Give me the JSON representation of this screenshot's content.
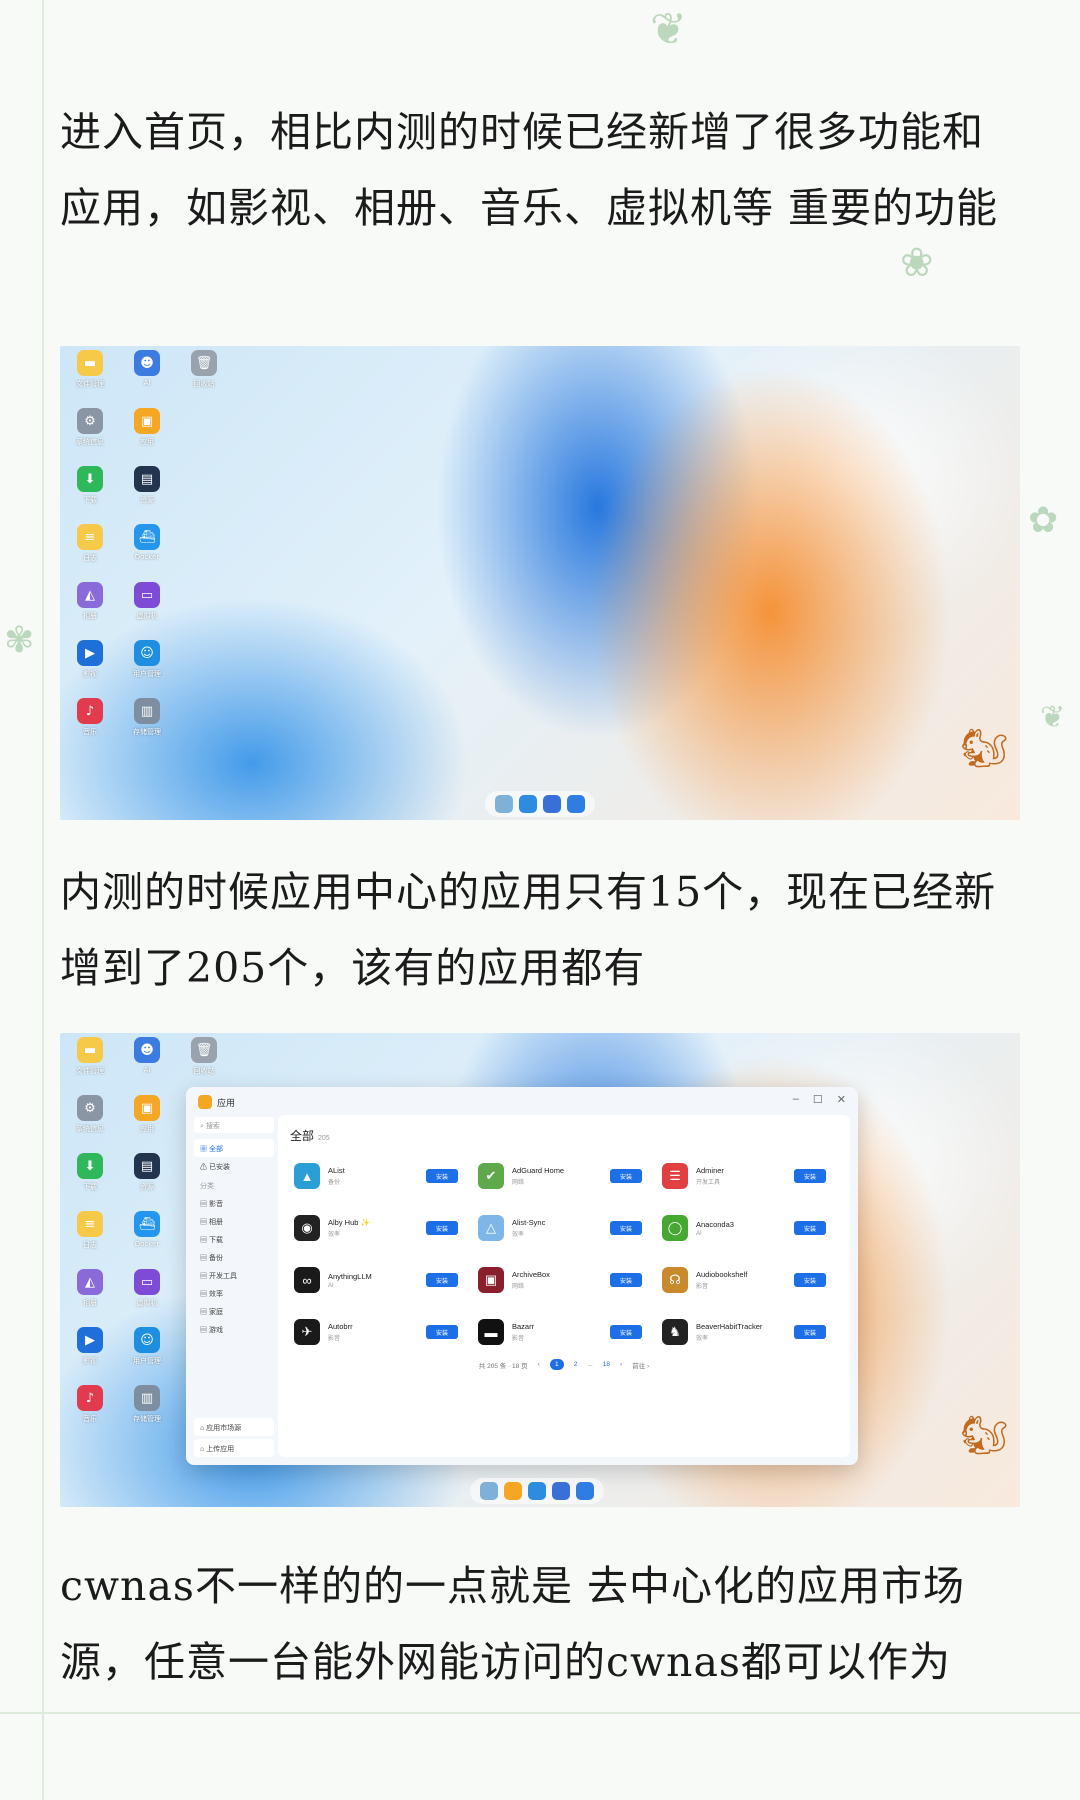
{
  "paragraphs": {
    "p1": "进入首页，相比内测的时候已经新增了很多功能和应用，如影视、相册、音乐、虚拟机等 重要的功能",
    "p2": "内测的时候应用中心的应用只有15个，现在已经新增到了205个，该有的应用都有",
    "p3": "cwnas不一样的的一点就是 去中心化的应用市场源，任意一台能外网能访问的cwnas都可以作为"
  },
  "desktop": {
    "icons": [
      {
        "label": "文件管理",
        "icon": "folder-icon",
        "color": "#f7c948"
      },
      {
        "label": "AI",
        "icon": "robot-icon",
        "color": "#3c7be0"
      },
      {
        "label": "回收站",
        "icon": "trash-icon",
        "color": "#9aa3ad"
      },
      {
        "label": "系统信息",
        "icon": "gear-icon",
        "color": "#8a96a3"
      },
      {
        "label": "应用",
        "icon": "app-store-icon",
        "color": "#f5a623"
      },
      {
        "label": "下载",
        "icon": "download-icon",
        "color": "#2fb85a"
      },
      {
        "label": "资源",
        "icon": "monitor-icon",
        "color": "#23344f"
      },
      {
        "label": "日志",
        "icon": "notes-icon",
        "color": "#f7c948"
      },
      {
        "label": "Docker",
        "icon": "docker-icon",
        "color": "#2496ed"
      },
      {
        "label": "相册",
        "icon": "photos-icon",
        "color": "#8a6ad8"
      },
      {
        "label": "虚拟机",
        "icon": "vm-icon",
        "color": "#7d4bd6"
      },
      {
        "label": "影视",
        "icon": "clapperboard-icon",
        "color": "#1e6fd9"
      },
      {
        "label": "用户管理",
        "icon": "users-icon",
        "color": "#1e8fe0"
      },
      {
        "label": "音乐",
        "icon": "music-icon",
        "color": "#e23b4e"
      },
      {
        "label": "存储管理",
        "icon": "storage-icon",
        "color": "#7d8ea0"
      }
    ],
    "dock1": [
      "#7fb0d8",
      "#2d8be0",
      "#3b6fd8",
      "#2f7de3"
    ],
    "dock2": [
      "#7fb0d8",
      "#f5a623",
      "#2d8be0",
      "#3b6fd8",
      "#2f7de3"
    ]
  },
  "appwin": {
    "title": "应用",
    "search_placeholder": "搜索",
    "nav": [
      {
        "label": "全部",
        "active": true
      },
      {
        "label": "已安装",
        "active": false
      }
    ],
    "group_label": "分类",
    "categories": [
      "影音",
      "相册",
      "下载",
      "备份",
      "开发工具",
      "效率",
      "家庭",
      "游戏"
    ],
    "bottom": [
      "应用市场源",
      "上传应用"
    ],
    "header": "全部",
    "header_count": "205",
    "install_label": "安装",
    "apps": [
      {
        "name": "AList",
        "cat": "备份",
        "icon": "alist-icon",
        "color": "#2a9fd6"
      },
      {
        "name": "AdGuard Home",
        "cat": "网络",
        "icon": "shield-check-icon",
        "color": "#5fa84c"
      },
      {
        "name": "Adminer",
        "cat": "开发工具",
        "icon": "database-icon",
        "color": "#e04040"
      },
      {
        "name": "Alby Hub ✨",
        "cat": "效率",
        "icon": "alby-icon",
        "color": "#222222"
      },
      {
        "name": "Alist-Sync",
        "cat": "效率",
        "icon": "alist-sync-icon",
        "color": "#7fb6e8"
      },
      {
        "name": "Anaconda3",
        "cat": "AI",
        "icon": "ring-icon",
        "color": "#44a833"
      },
      {
        "name": "AnythingLLM",
        "cat": "AI",
        "icon": "infinity-icon",
        "color": "#1a1a1a"
      },
      {
        "name": "ArchiveBox",
        "cat": "网络",
        "icon": "archive-icon",
        "color": "#8a1e2a"
      },
      {
        "name": "Audiobookshelf",
        "cat": "影音",
        "icon": "headphones-icon",
        "color": "#c88a2a"
      },
      {
        "name": "Autobrr",
        "cat": "影音",
        "icon": "bird-icon",
        "color": "#1a1a1a"
      },
      {
        "name": "Bazarr",
        "cat": "影音",
        "icon": "subtitle-icon",
        "color": "#111111"
      },
      {
        "name": "BeaverHabitTracker",
        "cat": "效率",
        "icon": "beaver-icon",
        "color": "#222222"
      }
    ],
    "pager": {
      "summary": "共 205 条 · 18 页",
      "prev": "‹",
      "pages": [
        "1",
        "2",
        "...",
        "18"
      ],
      "next": "›",
      "jump": "前往 ›"
    }
  }
}
